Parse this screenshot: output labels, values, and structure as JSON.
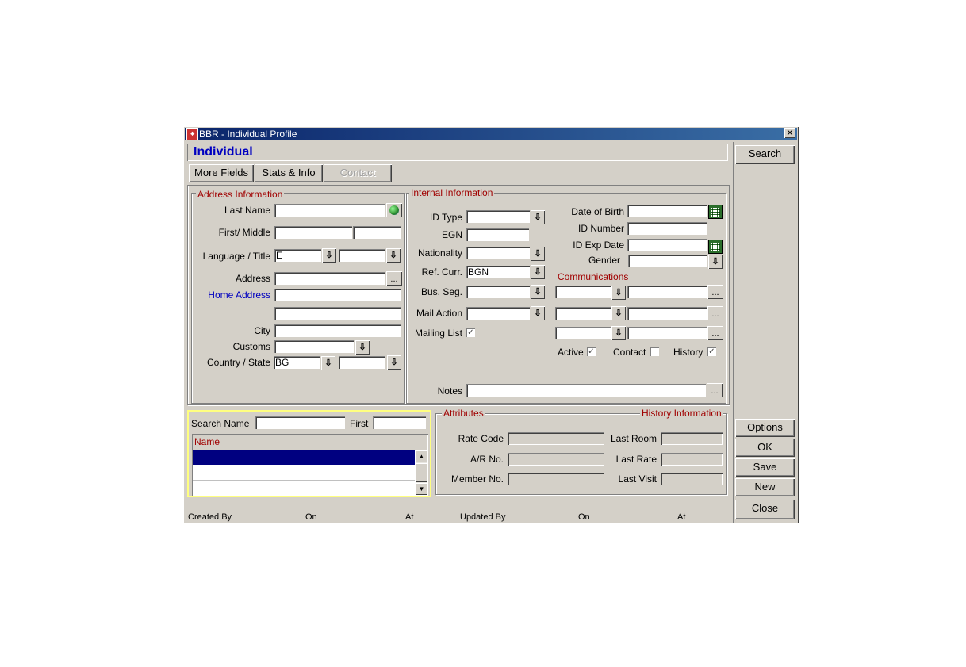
{
  "window": {
    "title": "BBR - Individual Profile",
    "close": "✕"
  },
  "banner": {
    "title": "Individual"
  },
  "tabs": {
    "more_fields": "More Fields",
    "stats_info": "Stats & Info",
    "contact": "Contact"
  },
  "address": {
    "group": "Address Information",
    "last_name_label": "Last Name",
    "last_name": "",
    "first_middle_label": "First/ Middle",
    "first": "",
    "middle": "",
    "language_title_label": "Language / Title",
    "language": "E",
    "title": "",
    "address_label": "Address",
    "address1": "",
    "home_address_label": "Home Address",
    "address2": "",
    "address3": "",
    "city_label": "City",
    "city": "",
    "customs_label": "Customs",
    "customs": "",
    "country_state_label": "Country / State",
    "country": "BG",
    "state": ""
  },
  "internal": {
    "group": "Internal Information",
    "id_type_label": "ID Type",
    "id_type": "",
    "egn_label": "EGN",
    "egn": "",
    "nationality_label": "Nationality",
    "nationality": "",
    "ref_curr_label": "Ref. Curr.",
    "ref_curr": "BGN",
    "bus_seg_label": "Bus. Seg.",
    "bus_seg": "",
    "mail_action_label": "Mail Action",
    "mail_action": "",
    "mailing_list_label": "Mailing List",
    "mailing_list_checked": true,
    "dob_label": "Date of Birth",
    "dob": "",
    "id_number_label": "ID Number",
    "id_number": "",
    "id_exp_label": "ID Exp Date",
    "id_exp": "",
    "gender_label": "Gender",
    "gender": "",
    "notes_label": "Notes",
    "notes": ""
  },
  "communications": {
    "group": "Communications",
    "active_label": "Active",
    "active_checked": true,
    "contact_label": "Contact",
    "contact_checked": false,
    "history_label": "History",
    "history_checked": true
  },
  "search": {
    "name_label": "Search Name",
    "name": "",
    "first_label": "First",
    "first": "",
    "grid_header": "Name"
  },
  "attributes": {
    "group": "Attributes",
    "history_group": "History Information",
    "rate_code_label": "Rate Code",
    "rate_code": "",
    "ar_no_label": "A/R No.",
    "ar_no": "",
    "member_no_label": "Member No.",
    "member_no": "",
    "last_room_label": "Last Room",
    "last_room": "",
    "last_rate_label": "Last Rate",
    "last_rate": "",
    "last_visit_label": "Last Visit",
    "last_visit": ""
  },
  "status": {
    "created_by": "Created By",
    "on1": "On",
    "at1": "At",
    "updated_by": "Updated By",
    "on2": "On",
    "at2": "At"
  },
  "side_buttons": {
    "search": "Search",
    "options": "Options",
    "ok": "OK",
    "save": "Save",
    "new": "New",
    "close": "Close"
  },
  "colors": {
    "title_bar": "#0a246a",
    "accent_red": "#a00000",
    "accent_blue": "#0000c0",
    "selection": "#000080"
  }
}
